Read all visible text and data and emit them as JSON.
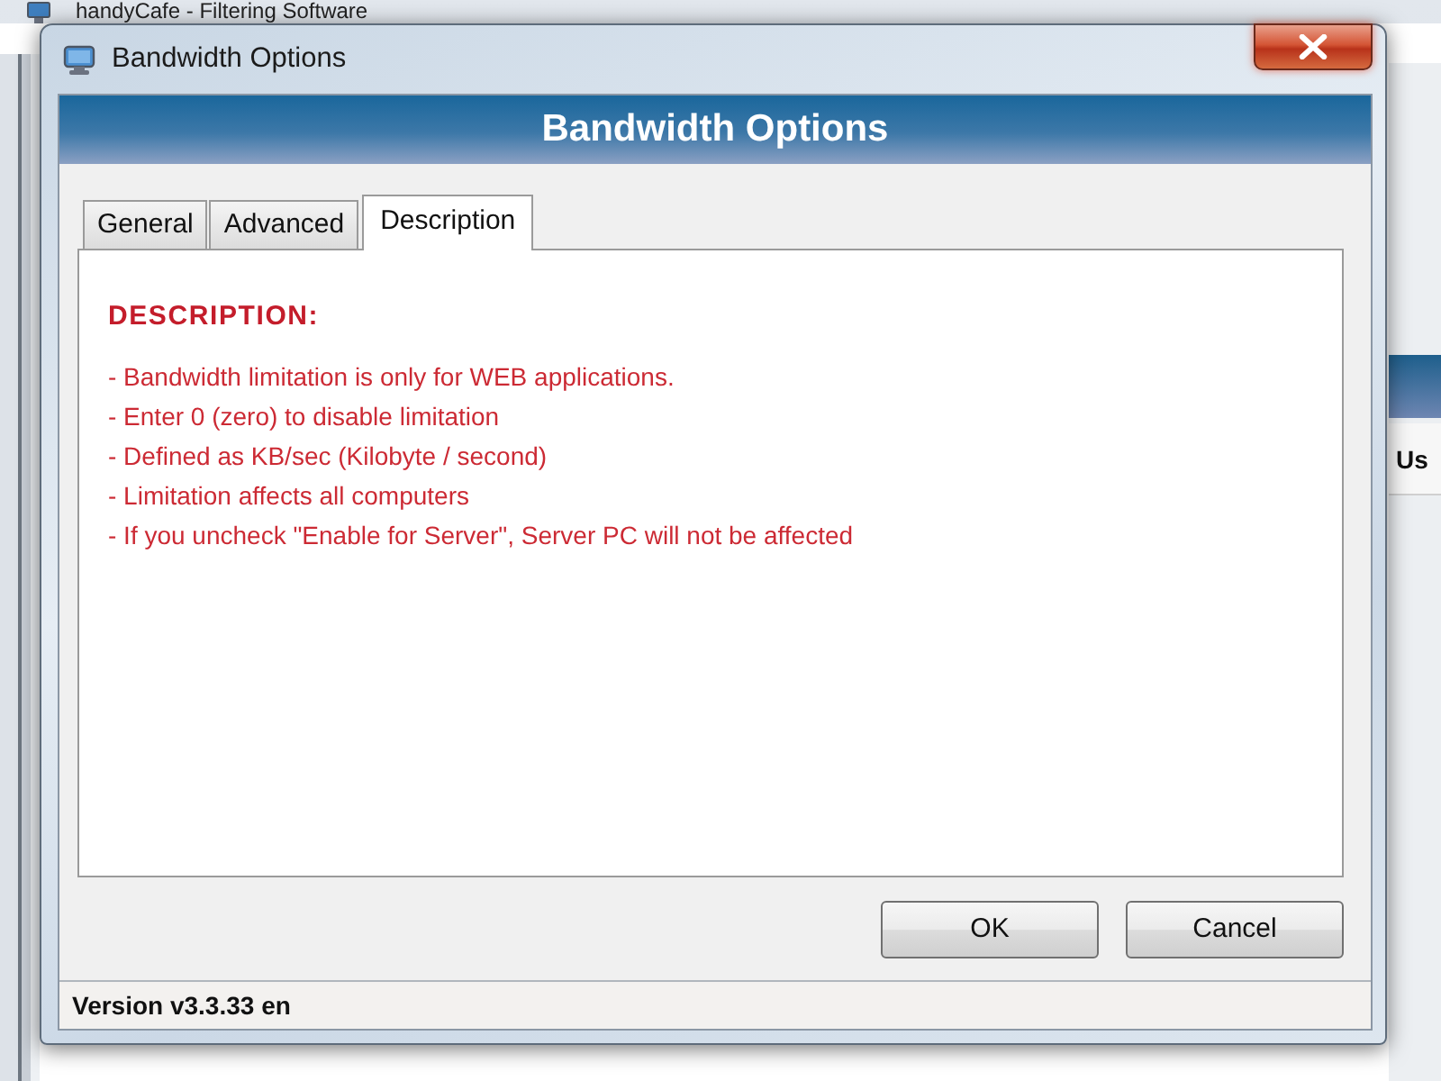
{
  "background_window": {
    "title": "handyCafe - Filtering Software",
    "column_header": "Us"
  },
  "dialog": {
    "title": "Bandwidth Options",
    "header": "Bandwidth Options"
  },
  "tabs": [
    {
      "label": "General",
      "selected": false
    },
    {
      "label": "Advanced",
      "selected": false
    },
    {
      "label": "Description",
      "selected": true
    }
  ],
  "description": {
    "heading": "DESCRIPTION:",
    "lines": [
      "- Bandwidth limitation is only for WEB applications.",
      "- Enter 0 (zero) to disable limitation",
      "- Defined as KB/sec (Kilobyte / second)",
      "- Limitation affects all computers",
      "- If you uncheck \"Enable for Server\", Server PC will not be affected"
    ]
  },
  "buttons": [
    "OK",
    "Cancel"
  ],
  "status_bar": {
    "text": "Version v3.3.33 en"
  }
}
